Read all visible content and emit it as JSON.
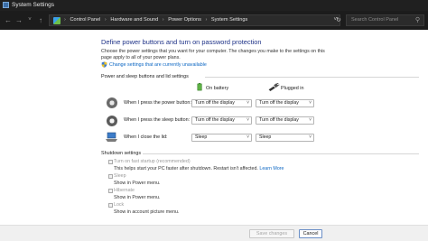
{
  "window": {
    "title": "System Settings"
  },
  "address_bar": {
    "breadcrumbs": [
      "Control Panel",
      "Hardware and Sound",
      "Power Options",
      "System Settings"
    ],
    "search_placeholder": "Search Control Panel"
  },
  "page": {
    "heading": "Define power buttons and turn on password protection",
    "description": "Choose the power settings that you want for your computer. The changes you make to the settings on this page apply to all of your power plans.",
    "change_link": "Change settings that are currently unavailable"
  },
  "power_section": {
    "title": "Power and sleep buttons and lid settings",
    "col_battery": "On battery",
    "col_plugged": "Plugged in",
    "rows": [
      {
        "label": "When I press the power button:",
        "battery": "Turn off the display",
        "plugged": "Turn off the display"
      },
      {
        "label": "When I press the sleep button:",
        "battery": "Turn off the display",
        "plugged": "Turn off the display"
      },
      {
        "label": "When I close the lid:",
        "battery": "Sleep",
        "plugged": "Sleep"
      }
    ]
  },
  "shutdown_section": {
    "title": "Shutdown settings",
    "fast_startup": {
      "label": "Turn on fast startup (recommended)",
      "desc": "This helps start your PC faster after shutdown. Restart isn't affected.",
      "learn_more": "Learn More"
    },
    "sleep": {
      "label": "Sleep",
      "desc": "Show in Power menu."
    },
    "hibernate": {
      "label": "Hibernate",
      "desc": "Show in Power menu."
    },
    "lock": {
      "label": "Lock",
      "desc": "Show in account picture menu."
    }
  },
  "footer": {
    "save": "Save changes",
    "cancel": "Cancel"
  },
  "colors": {
    "heading": "#1e3287",
    "link": "#0b66c3",
    "titlebar": "#202020"
  }
}
